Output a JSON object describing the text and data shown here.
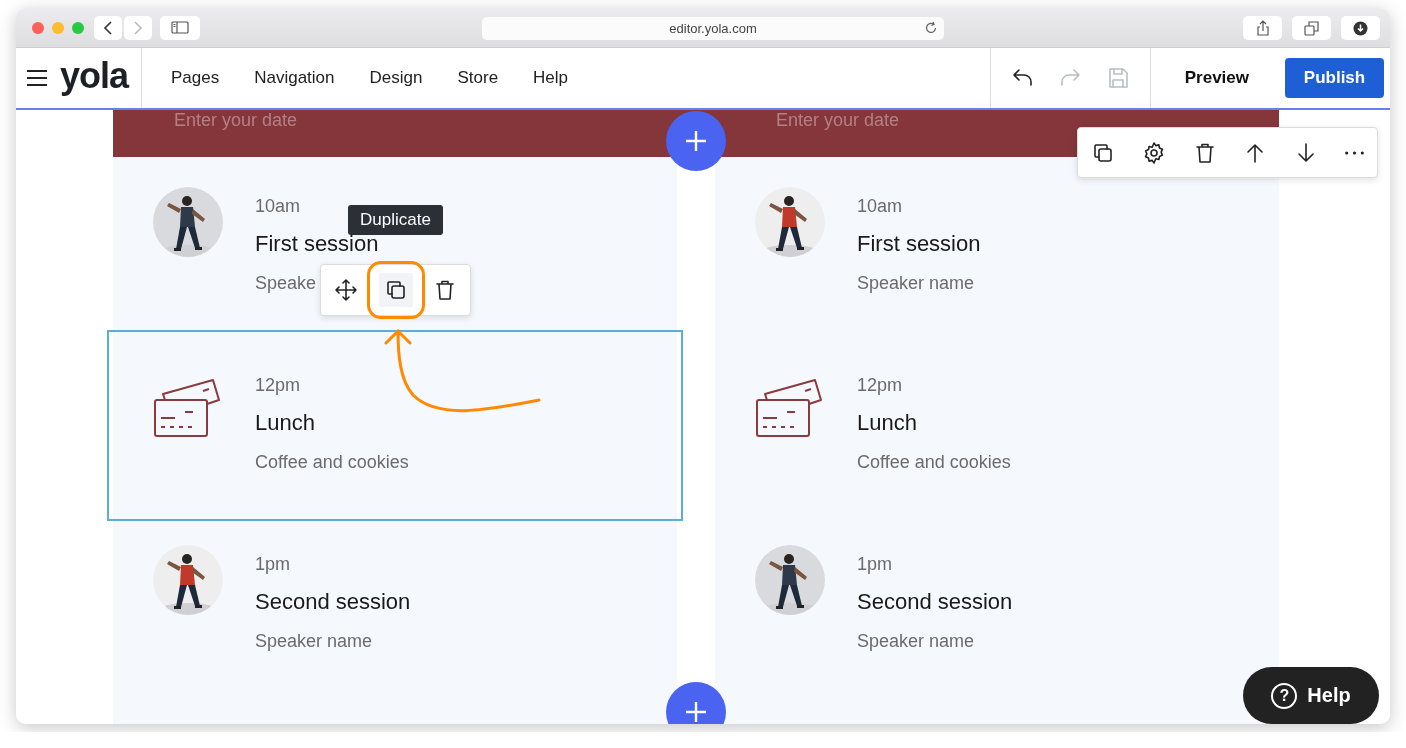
{
  "browser": {
    "url": "editor.yola.com"
  },
  "header": {
    "logo": "yola",
    "nav": [
      {
        "label": "Pages"
      },
      {
        "label": "Navigation"
      },
      {
        "label": "Design"
      },
      {
        "label": "Store"
      },
      {
        "label": "Help"
      }
    ],
    "history": [
      {
        "kind": "undo",
        "disabled": false
      },
      {
        "kind": "redo",
        "disabled": true
      },
      {
        "kind": "save",
        "disabled": true
      }
    ],
    "preview": "Preview",
    "publish": "Publish"
  },
  "section": {
    "date_band": [
      "Enter your date",
      "Enter your date"
    ],
    "columns": [
      {
        "sessions": [
          {
            "time": "10am",
            "title": "First session",
            "subtitle": "Speake",
            "selected": false
          },
          {
            "kind": "icon",
            "time": "12pm",
            "title": "Lunch",
            "subtitle": "Coffee and cookies",
            "selected": true
          },
          {
            "time": "1pm",
            "title": "Second session",
            "subtitle": "Speaker name",
            "selected": false
          }
        ]
      },
      {
        "sessions": [
          {
            "time": "10am",
            "title": "First session",
            "subtitle": "Speaker name",
            "selected": false
          },
          {
            "kind": "icon",
            "time": "12pm",
            "title": "Lunch",
            "subtitle": "Coffee and cookies",
            "selected": false
          },
          {
            "time": "1pm",
            "title": "Second session",
            "subtitle": "Speaker name",
            "selected": false
          }
        ]
      }
    ]
  },
  "section_toolbar": [
    {
      "kind": "duplicate"
    },
    {
      "kind": "settings"
    },
    {
      "kind": "delete"
    },
    {
      "kind": "up"
    },
    {
      "kind": "down"
    },
    {
      "kind": "more"
    }
  ],
  "element_toolbar": {
    "tooltip": "Duplicate",
    "buttons": [
      {
        "kind": "move",
        "highlighted": false
      },
      {
        "kind": "duplicate",
        "highlighted": true
      },
      {
        "kind": "delete",
        "highlighted": false
      }
    ]
  },
  "help": {
    "icon": "?",
    "label": "Help"
  }
}
